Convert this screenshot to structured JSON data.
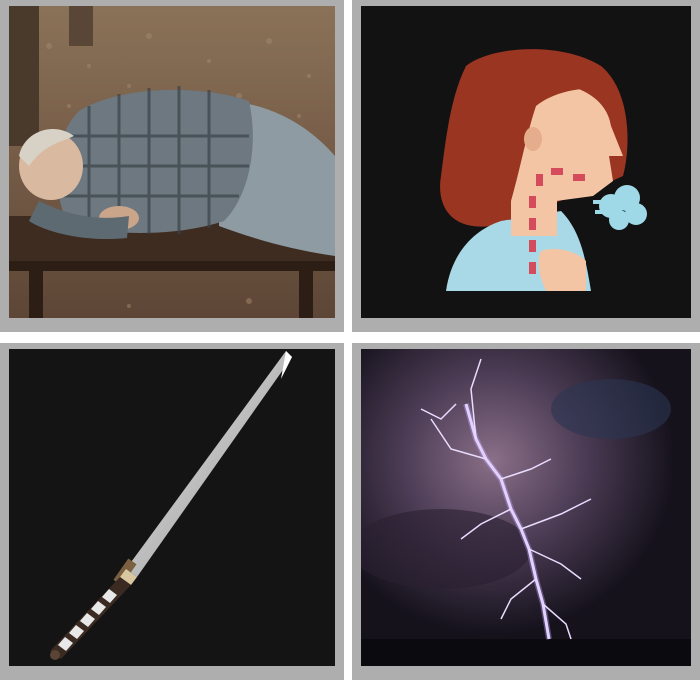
{
  "game": {
    "title": "",
    "tiles": [
      {
        "id": 1,
        "picture": "man-sleeping-on-bench"
      },
      {
        "id": 2,
        "picture": "woman-coughing-breath-illustration"
      },
      {
        "id": 3,
        "picture": "katana-sword"
      },
      {
        "id": 4,
        "picture": "lightning-storm"
      }
    ]
  },
  "colors": {
    "frame": "#aeaeae",
    "tile_background_dark": "#121212",
    "accent_red": "#d44b5c",
    "breath_blue": "#9fd8e6"
  }
}
